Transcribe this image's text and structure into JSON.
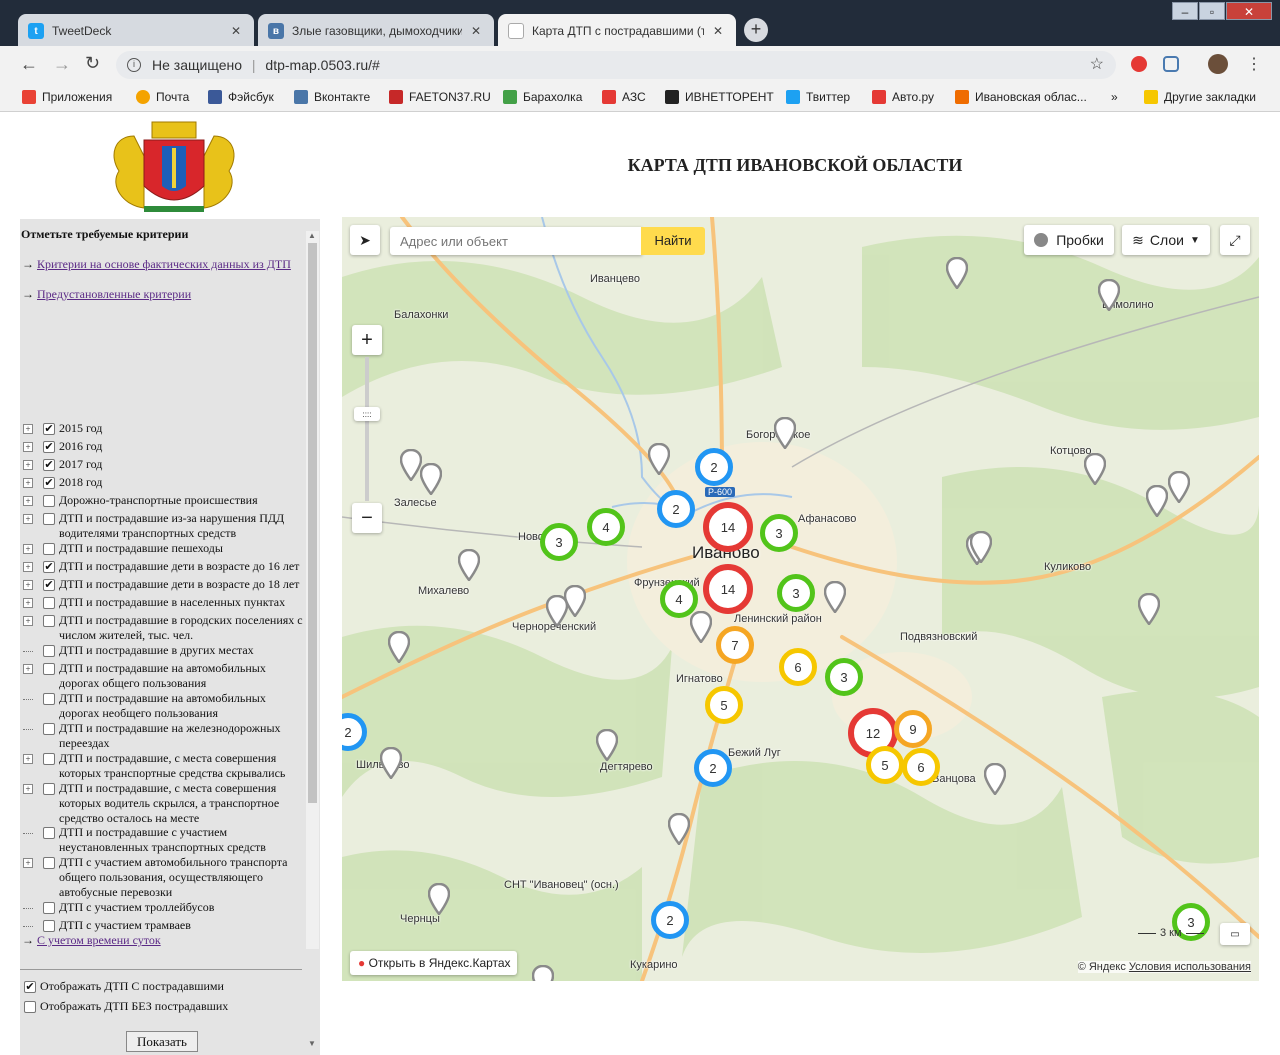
{
  "browser": {
    "tabs": [
      {
        "label": "TweetDeck",
        "icon": "twitter-icon",
        "color": "#1da1f2",
        "active": false
      },
      {
        "label": "Злые газовщики, дымоходчики",
        "icon": "vk-icon",
        "color": "#4a76a8",
        "active": false
      },
      {
        "label": "Карта ДТП с пострадавшими (то",
        "icon": "page-icon",
        "color": "#888888",
        "active": true
      }
    ],
    "url": "dtp-map.0503.ru/#",
    "security": "Не защищено",
    "bookmarks": [
      {
        "label": "Приложения",
        "color": "#e94235"
      },
      {
        "label": "Почта",
        "color": "#f4a300"
      },
      {
        "label": "Фэйсбук",
        "color": "#3b5998"
      },
      {
        "label": "Вконтакте",
        "color": "#4a76a8"
      },
      {
        "label": "FAETON37.RU",
        "color": "#c62828"
      },
      {
        "label": "Барахолка",
        "color": "#43a047"
      },
      {
        "label": "АЗС",
        "color": "#e53935"
      },
      {
        "label": "ИВНЕТТОРЕНТ",
        "color": "#222222"
      },
      {
        "label": "Твиттер",
        "color": "#1da1f2"
      },
      {
        "label": "Авто.ру",
        "color": "#e53935"
      },
      {
        "label": "Ивановская облас...",
        "color": "#ef6c00"
      }
    ],
    "more": "»",
    "other_bookmarks": "Другие закладки"
  },
  "page": {
    "title": "КАРТА ДТП ИВАНОВСКОЙ ОБЛАСТИ",
    "panel": {
      "heading": "Отметьте требуемые критерии",
      "link1": "Критерии на основе фактических данных из ДТП",
      "link2": "Предустановленные критерии",
      "link3": "С учетом времени суток",
      "arrow": "→",
      "criteria": [
        {
          "text": "2015 год",
          "checked": true,
          "expand": true
        },
        {
          "text": "2016 год",
          "checked": true,
          "expand": true
        },
        {
          "text": "2017 год",
          "checked": true,
          "expand": true
        },
        {
          "text": "2018 год",
          "checked": true,
          "expand": true
        },
        {
          "text": "Дорожно-транспортные происшествия",
          "checked": false,
          "expand": true
        },
        {
          "text": "ДТП и пострадавшие из-за нарушения ПДД водителями транспортных средств",
          "checked": false,
          "expand": true
        },
        {
          "text": "ДТП и пострадавшие пешеходы",
          "checked": false,
          "expand": true
        },
        {
          "text": "ДТП и пострадавшие дети в возрасте до 16 лет",
          "checked": true,
          "expand": true
        },
        {
          "text": "ДТП и пострадавшие дети в возрасте до 18 лет",
          "checked": true,
          "expand": true
        },
        {
          "text": "ДТП и пострадавшие в населенных пунктах",
          "checked": false,
          "expand": true
        },
        {
          "text": "ДТП и пострадавшие в городских поселениях с числом жителей, тыс. чел.",
          "checked": false,
          "expand": true
        },
        {
          "text": "ДТП и пострадавшие в других местах",
          "checked": false,
          "expand": false
        },
        {
          "text": "ДТП и пострадавшие на автомобильных дорогах общего пользования",
          "checked": false,
          "expand": true
        },
        {
          "text": "ДТП и пострадавшие на автомобильных дорогах необщего пользования",
          "checked": false,
          "expand": false
        },
        {
          "text": "ДТП и пострадавшие на железнодорожных переездах",
          "checked": false,
          "expand": false
        },
        {
          "text": "ДТП и пострадавшие, с места совершения которых транспортные средства скрывались",
          "checked": false,
          "expand": true
        },
        {
          "text": "ДТП и пострадавшие, с места совершения которых водитель скрылся, а транспортное средство осталось на месте",
          "checked": false,
          "expand": true
        },
        {
          "text": "ДТП и пострадавшие с участием неустановленных транспортных средств",
          "checked": false,
          "expand": false
        },
        {
          "text": "ДТП с участием автомобильного транспорта общего пользования, осуществляющего автобусные перевозки",
          "checked": false,
          "expand": true
        },
        {
          "text": "ДТП с участием троллейбусов",
          "checked": false,
          "expand": false
        },
        {
          "text": "ДТП с участием трамваев",
          "checked": false,
          "expand": false
        }
      ],
      "option_with": "Отображать ДТП С пострадавшими",
      "option_with_checked": true,
      "option_without": "Отображать ДТП БЕЗ пострадавших",
      "option_without_checked": false,
      "button": "Показать"
    },
    "map": {
      "search_placeholder": "Адрес или объект",
      "search_button": "Найти",
      "traffic": "Пробки",
      "layers": "Слои",
      "zoom_in": "+",
      "zoom_out": "−",
      "open_in": "Открыть в Яндекс.Картах",
      "copyright": "© Яндекс",
      "terms": "Условия использования",
      "scale": "3 км",
      "road_label": "Р-600",
      "city": "Иваново",
      "places": [
        "Иванцево",
        "Балахонки",
        "Богородское",
        "Котцово",
        "Залесье",
        "Афанасово",
        "Куликово",
        "Михалево",
        "Чернореченский",
        "Ленинский район",
        "Подвязновский",
        "Игнатово",
        "Дегтярево",
        "Шилыково",
        "Бежий Луг",
        "Ванцова",
        "СНТ \"Ивановец\" (осн.)",
        "Чернцы",
        "Кукарино",
        "Бимолино",
        "Новоселко",
        "Фрунзенский"
      ],
      "clusters": [
        {
          "n": "2",
          "color": "#2196f3"
        },
        {
          "n": "2",
          "color": "#2196f3"
        },
        {
          "n": "14",
          "color": "#e53935"
        },
        {
          "n": "3",
          "color": "#52c41a"
        },
        {
          "n": "4",
          "color": "#52c41a"
        },
        {
          "n": "3",
          "color": "#52c41a"
        },
        {
          "n": "14",
          "color": "#e53935"
        },
        {
          "n": "4",
          "color": "#52c41a"
        },
        {
          "n": "3",
          "color": "#52c41a"
        },
        {
          "n": "7",
          "color": "#f5a623"
        },
        {
          "n": "6",
          "color": "#f6c700"
        },
        {
          "n": "3",
          "color": "#52c41a"
        },
        {
          "n": "5",
          "color": "#f6c700"
        },
        {
          "n": "12",
          "color": "#e53935"
        },
        {
          "n": "9",
          "color": "#f5a623"
        },
        {
          "n": "5",
          "color": "#f6c700"
        },
        {
          "n": "6",
          "color": "#f6c700"
        },
        {
          "n": "2",
          "color": "#2196f3"
        },
        {
          "n": "2",
          "color": "#2196f3"
        },
        {
          "n": "2",
          "color": "#2196f3"
        },
        {
          "n": "3",
          "color": "#52c41a"
        }
      ]
    }
  }
}
